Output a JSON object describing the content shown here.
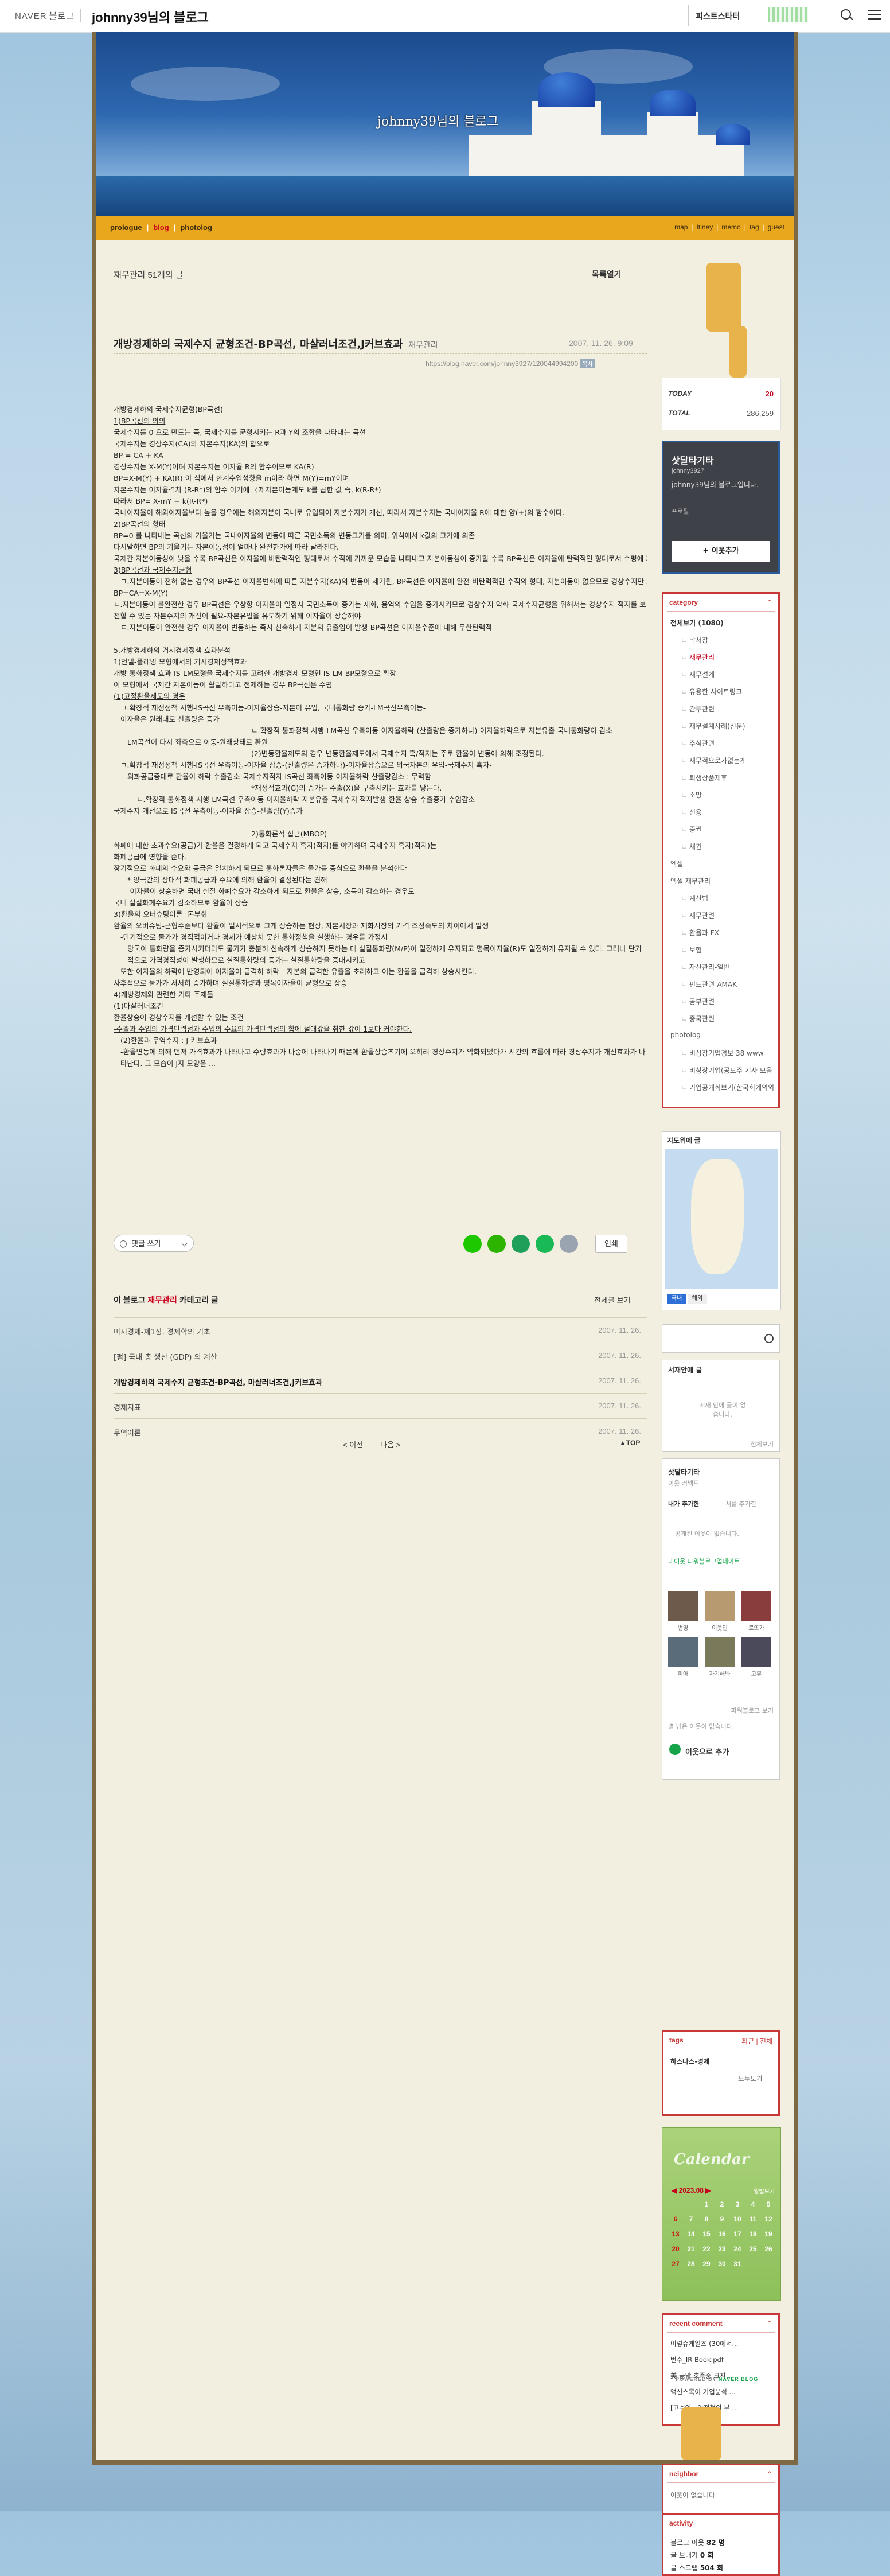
{
  "topbar": {
    "brand": "NAVER",
    "brand_sub": "블로그",
    "blog_title": "johnny39님의 블로그",
    "banner_text": "피스트스타터"
  },
  "header": {
    "title": "johnny39님의 블로그"
  },
  "nav": {
    "prologue": "prologue",
    "blog": "blog",
    "photolog": "photolog",
    "right": [
      "map",
      "Itlney",
      "memo",
      "tag",
      "guest"
    ]
  },
  "post": {
    "crumb_cat": "재무관리",
    "crumb_count": "51개의 글",
    "list_toggle": "목록열기",
    "title": "개방경제하의 국제수지 균형조건-BP곡선, 마샬러너조건,J커브효과",
    "category": "재무관리",
    "date": "2007. 11. 26. 9:09",
    "url": "https://blog.naver.com/johnny3927/120044994200",
    "url_badge": "복사",
    "lines": [
      "개방경제하의 국제수지균형(BP곡선)",
      "1)BP곡선의 의의",
      "국제수지를 0 으로 만드는 즉, 국제수지를 균형시키는 R과 Y의 조합을 나타내는 곡선",
      "국제수지는 경상수지(CA)와 자본수지(KA)의 합으로",
      "BP = CA + KA",
      "경상수지는 X-M(Y)이며 자본수지는 이자율 R의 함수이므로 KA(R)",
      "BP=X-M(Y) + KA(R)   이 식에서 한계수입성향을 m이라 하면 M(Y)=mY이며",
      "자본수지는 이자율격차 (R-R*)의 함수 이기에 국제자본이동계도 k를 곱한 값 즉, k(R-R*)",
      "따라서 BP= X-mY + k(R-R*)",
      "국내이자율이 해외이자율보다 높을 경우에는 해외자본이 국내로 유입되어 자본수지가 개선, 따라서 자본수지는 국내이자율 R에 대한 양(+)의 함수이다.",
      "2)BP곡선의 형태",
      "BP=0 를 나타내는 곡선의 기울기는 국내이자율의 변동에 따른 국민소득의 변동크기를 의미, 위식에서 k값의 크기에 의존",
      "다시말하면 BP의 기울기는 자본이동성이 얼마나 완전한가에 따라 달라진다.",
      "국제간 자본이동성이 낮을 수록 BP곡선은 이자율에 비탄력적인 형태로서 수직에 가까운 모습을 나타내고 자본이동성이 증가할 수록 BP곡선은 이자율에 탄력적인 형태로서 수평에 가까운 모습으로 나타난다",
      "3)BP곡선과 국제수지균형",
      "ㄱ.자본이동이 전혀 없는 경우의 BP곡선-이자율변화에 따른 자본수지(KA)의 변동이 제거될, BP곡선은 이자율에 완전 비탄력적인 수직의 형태, 자본이동이 없으므로 경상수지만 고려하면 OK",
      "BP=CA=X-M(Y)",
      "ㄴ.자본이동이 불완전한 경우 BP곡선은 우상향-이자율이 일정시 국민소득이 증가는 재화, 용역의 수입을 증가시키므로 경상수지 악화-국제수지균형을 위해서는 경상수지 적자를 보전할 수 있는 자본수지의 개선이 필요-자본유입을 유도하기 위해 이자율이 상승해야",
      "ㄷ.자본이동이 완전한 경우-이자율이 변동하는 즉시 신속하게 자본의 유출입이 발생-BP곡선은 이자율수준에 대해 무한탄력적",
      "",
      "5.개방경제하의 거시경제정책 효과분석",
      "1)먼델-플레밍 모형에서의 거시경제정책효과",
      "개방-통화정책 효과-IS-LM모형을 국제수지를 고려한 개방경제 모형인 IS-LM-BP모형으로 확장",
      "이 모형에서 국제간 자본이동이 활발하다고 전제하는 경우 BP곡선은 수평",
      "(1)고정환율제도의 경우",
      "ㄱ.확장적 재정정책 시행-IS곡선 우측이동-이자율상승-자본이 유입, 국내통화량 증가-LM곡선우측이동-",
      "이자율은 원래대로 산출량은 증가",
      "ㄴ.확장적 통화정책 시행-LM곡선 우측이동-이자율하락-(산출량은 증가하나)-이자율하락으로 자본유출-국내통화량이 감소-",
      "LM곡선이 다시 좌측으로 이동-원래상태로 환원",
      "(2)변동환율제도의 경우-변동환율제도에서 국제수지 흑/적자는 주로 환율이 변동에 의해 조정된다.",
      "ㄱ.확장적 재정정책 시행-IS곡선 우측이동-이자율 상승-(산출량은 증가하나)-이자율상승으로 외국자본의 유입-국제수지 흑자-",
      "외화공급증대로 환율이 하락-수출감소-국제수지적자-IS곡선 좌측이동-이자율하락-산출량감소 : 무력함",
      "*재정적효과(G)의 증가는 수출(X)을 구축시키는 효과를 낳는다.",
      "ㄴ.확장적 통화정책 시행-LM곡선 우측이동-이자율하락-자본유출-국제수지 적자발생-환율 상승-수출증가 수입감소-",
      "국제수지 개선으로 IS곡선 우측이동-이자율 상승-산출량(Y)증가",
      "",
      "2)통화론적 접근(MBOP)",
      "화폐에 대한 초과수요(공급)가 환율을 결정하게 되고 국제수지 흑자(적자)를 야기하며 국제수지 흑자(적자)는",
      "화폐공급에 영향을 준다.",
      "장기적으로 화폐의 수요와 공급은 일치하게 되므로 통화론자들은 물가를 중심으로 환율을 분석한다",
      "* 양국간의 상대적 화폐공급과 수요에 의해 환율이 결정된다는 견해",
      "-이자율이 상승하면 국내 실질 화폐수요가 감소하게 되므로 환율은 상승, 소득이 감소하는 경우도",
      "국내 실질화폐수요가 감소하므로 환율이 상승",
      "3)환율의 오버슈팅이론 -돈부쉬",
      "환율의 오버슈팅-균형수준보다 환율이 일시적으로 크게 상승하는 현상, 자본시장과 재화시장의 가격 조정속도의 차이에서 발생",
      "-단기적으로 물가가 경직적이거나 경제가 예상치 못한 통화정책을 실행하는 경우를 가정시",
      "당국이 통화량을 증가시키더라도 물가가 충분히 신속하게 상승하지 못하는 데 실질통화량(M/P)이 일정하게 유지되고 명목이자율(R)도 일정하게 유지될 수 있다. 그러나 단기적으로 가격경직성이 발생하므로 실질통화량의 증가는 실질통화량을 증대시키고",
      "또한 이자율의 하락에 반영되어 이자율이 급격히 하락---자본의 급격한 유출을 초래하고 이는 환율을 급격히 상승시킨다.",
      "사후적으로 물가가 서서히 증가하며 실질통화량과 명목이자율이 균형으로 상승",
      "4)개방경제와 관련한 기타 주제들",
      "(1)마샬러너조건",
      "환율상승이 경상수지를 개선할 수 있는 조건",
      "-수출과 수입의 가격탄력성과 수입의 수요의 가격탄력성의 합에 절대값을 취한 값이 1보다 커야한다.",
      "(2)환율과 무역수지 : J-커브효과",
      "-환율변동에 의해 먼저 가격효과가 나타나고 수량효과가 나중에 나타나기 때문에 환율상승초기에 오히려 경상수지가 악화되었다가 시간의 흐름에 따라 경상수지가 개선효과가 나타난다. 그 모습이 J자 모양을 ..."
    ],
    "sympathy": "댓글 쓰기",
    "print": "인쇄"
  },
  "catposts": {
    "header_prefix": "이 블로그",
    "header_cat": "재무관리",
    "header_suffix": "카테고리 글",
    "all": "전체글 보기",
    "rows": [
      {
        "title": "미시경제-제1장. 경제학의 기초",
        "date": "2007. 11. 26."
      },
      {
        "title": "[펌] 국내 총 생산 (GDP) 의 계산",
        "date": "2007. 11. 26."
      },
      {
        "title": "개방경제하의 국제수지 균형조건-BP곡선, 마샬러너조건,J커브효과",
        "date": "2007. 11. 26."
      },
      {
        "title": "경제지표",
        "date": "2007. 11. 26."
      },
      {
        "title": "무역이론",
        "date": "2007. 11. 26."
      }
    ],
    "prev": "이전",
    "next": "다음",
    "top": "TOP"
  },
  "side": {
    "today_label": "TODAY",
    "today": "20",
    "total_label": "TOTAL",
    "total": "286,259",
    "profile": {
      "name": "삿달타기타",
      "id": "johnny3927",
      "desc": "johnny39님의 블로그입니다.",
      "link": "프로필",
      "add": "이웃추가"
    },
    "category": {
      "title": "category",
      "items": [
        {
          "label": "전체보기 (1080)",
          "type": "top"
        },
        {
          "label": "낙서장",
          "type": "sub"
        },
        {
          "label": "재무관리",
          "type": "sub cur"
        },
        {
          "label": "재무설계",
          "type": "sub"
        },
        {
          "label": "유용한 사이트링크",
          "type": "sub"
        },
        {
          "label": "간투관련",
          "type": "sub"
        },
        {
          "label": "재무설계사례(신문)",
          "type": "sub"
        },
        {
          "label": "주식관련",
          "type": "sub"
        },
        {
          "label": "재무적으로가없는게",
          "type": "sub"
        },
        {
          "label": "퇴생상품제휴",
          "type": "sub"
        },
        {
          "label": "소망",
          "type": "sub"
        },
        {
          "label": "신용",
          "type": "sub"
        },
        {
          "label": "증권",
          "type": "sub"
        },
        {
          "label": "채권",
          "type": "sub"
        },
        {
          "label": "엑셀",
          "type": "nob"
        },
        {
          "label": "엑셀 재무관리",
          "type": "nob"
        },
        {
          "label": "계산법",
          "type": "sub"
        },
        {
          "label": "세무관련",
          "type": "sub"
        },
        {
          "label": "환율과 FX",
          "type": "sub"
        },
        {
          "label": "보험",
          "type": "sub"
        },
        {
          "label": "자산관리-일반",
          "type": "sub"
        },
        {
          "label": "펀드관련-AMAK",
          "type": "sub"
        },
        {
          "label": "공부관련",
          "type": "sub"
        },
        {
          "label": "중국관련",
          "type": "sub"
        },
        {
          "label": "photolog",
          "type": "nob"
        },
        {
          "label": "비상장기업경보 38 www",
          "type": "sub"
        },
        {
          "label": "비상장기업(공모주 기사 모음",
          "type": "sub"
        },
        {
          "label": "기업공개회보기(한국회계의외",
          "type": "sub"
        }
      ]
    },
    "map": {
      "title": "지도위에 글",
      "btn1": "국내",
      "btn2": "해외"
    },
    "mobile": {
      "title": "서재안에 글",
      "empty": "서재 안에 글이 없습니다.",
      "more": "전체보기"
    },
    "neighbor_box": {
      "name": "삿달타기타",
      "sub": "이웃 커넥트",
      "tab1": "내가 추가한",
      "tab2": "서를 추가한",
      "empty": "공개된 이웃이 없습니다.",
      "recent": "내이웃 파워블로그업데이트",
      "names": [
        "번영",
        "이웃인",
        "로또가",
        "피아",
        "자기해봐",
        "고뮤"
      ],
      "more": "파워블로그 보기",
      "note": "별 넘은 이웃이 없습니다.",
      "add": "이웃으로 추가"
    },
    "tags": {
      "title": "tags",
      "links": "최근 | 전체",
      "item": "하스나스-경제",
      "more": "모두보기"
    },
    "calendar": {
      "title": "Calendar",
      "month": "2023.08",
      "right": "월별보기",
      "days": [
        "1",
        "2",
        "3",
        "4",
        "5",
        "6",
        "7",
        "8",
        "9",
        "10",
        "11",
        "12",
        "13",
        "14",
        "15",
        "16",
        "17",
        "18",
        "19",
        "20",
        "21",
        "22",
        "23",
        "24",
        "25",
        "26",
        "27",
        "28",
        "29",
        "30",
        "31"
      ]
    },
    "recent_comment": {
      "title": "recent comment",
      "items": [
        "이렇슈게일즈 (30에서...",
        "번수_IR Book.pdf",
        "美 금막 호족중 크지 ...",
        "액션스목이 기업분석 ...",
        "[고수익 · 안정형의 부 ..."
      ]
    },
    "neighbor": {
      "title": "neighbor",
      "empty": "이웃이 없습니다."
    },
    "activity": {
      "title": "activity",
      "l1": "블로그 이웃",
      "v1": "82 명",
      "l2": "글 보내기",
      "v2": "0 회",
      "l3": "글 스크랩",
      "v3": "504 회"
    },
    "powered": "POWERED BY",
    "powered_brand": "NAVER BLOG"
  },
  "colors": {
    "accent_red": "#c8001e",
    "nav_orange": "#e9a71d",
    "frame_brown": "#7d6a44",
    "widget_red": "#c93838"
  }
}
